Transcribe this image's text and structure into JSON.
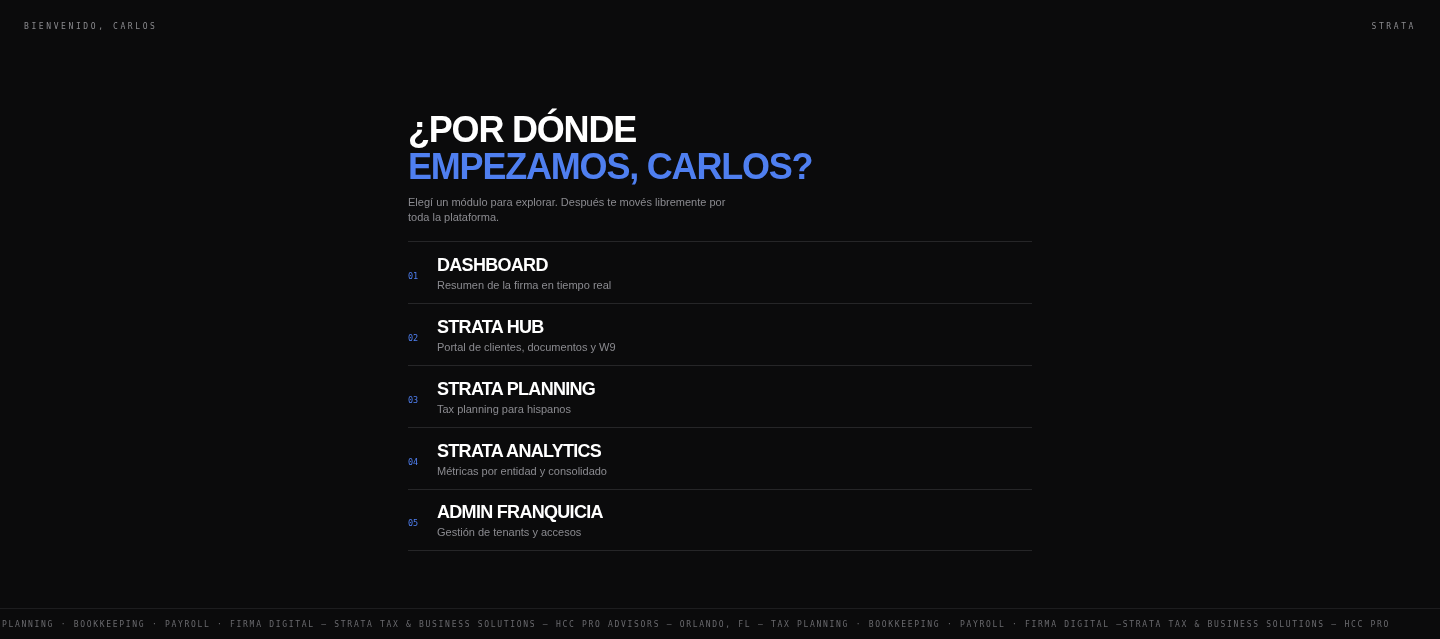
{
  "header": {
    "greeting": "BIENVENIDO, CARLOS",
    "brand": "STRATA"
  },
  "hero": {
    "title_line_1": "¿POR DÓNDE",
    "title_line_2": "EMPEZAMOS, CARLOS?",
    "subtitle": "Elegí un módulo para explorar. Después te movés libremente por toda la plataforma."
  },
  "modules": [
    {
      "number": "01",
      "title": "DASHBOARD",
      "description": "Resumen de la firma en tiempo real"
    },
    {
      "number": "02",
      "title": "STRATA HUB",
      "description": "Portal de clientes, documentos y W9"
    },
    {
      "number": "03",
      "title": "STRATA PLANNING",
      "description": "Tax planning para hispanos"
    },
    {
      "number": "04",
      "title": "STRATA ANALYTICS",
      "description": "Métricas por entidad y consolidado"
    },
    {
      "number": "05",
      "title": "ADMIN FRANQUICIA",
      "description": "Gestión de tenants y accesos"
    }
  ],
  "ticker": "PLANNING · BOOKKEEPING · PAYROLL · FIRMA DIGITAL — STRATA TAX & BUSINESS SOLUTIONS — HCC PRO ADVISORS — ORLANDO, FL — TAX PLANNING · BOOKKEEPING · PAYROLL · FIRMA DIGITAL —STRATA TAX & BUSINESS SOLUTIONS — HCC PRO"
}
